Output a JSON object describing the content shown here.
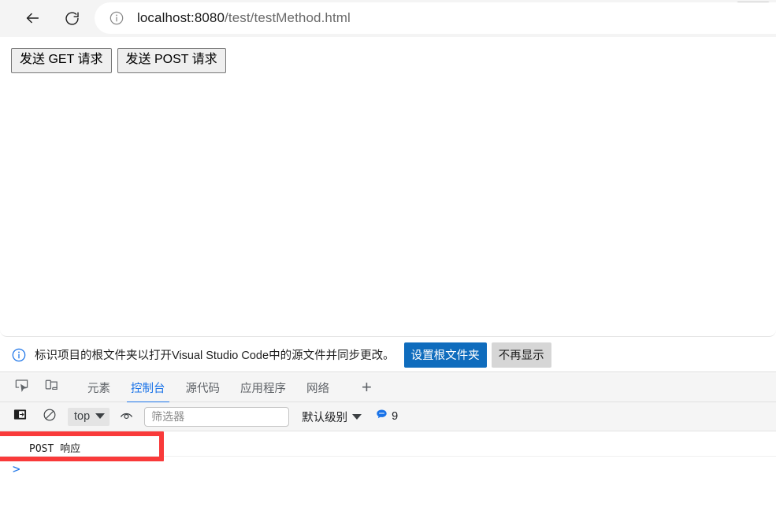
{
  "browser": {
    "back_icon": "back-arrow-icon",
    "reload_icon": "reload-icon",
    "info_icon": "info-circle-icon",
    "url_host": "localhost:8080",
    "url_path": "/test/testMethod.html"
  },
  "page": {
    "buttons": [
      {
        "label": "发送 GET 请求"
      },
      {
        "label": "发送 POST 请求"
      }
    ]
  },
  "infobar": {
    "icon": "info-circle-icon",
    "message": "标识项目的根文件夹以打开Visual Studio Code中的源文件并同步更改。",
    "primary_button": "设置根文件夹",
    "secondary_button": "不再显示",
    "primary_color": "#0f6cbd"
  },
  "devtools": {
    "inspect_icon": "inspect-element-icon",
    "device_icon": "device-toolbar-icon",
    "tabs": [
      {
        "label": "元素",
        "active": false
      },
      {
        "label": "控制台",
        "active": true
      },
      {
        "label": "源代码",
        "active": false
      },
      {
        "label": "应用程序",
        "active": false
      },
      {
        "label": "网络",
        "active": false
      }
    ],
    "more_tabs_label": "+",
    "active_tab_color": "#1a73e8"
  },
  "console_toolbar": {
    "sidebar_icon": "console-sidebar-icon",
    "clear_icon": "clear-console-icon",
    "context_label": "top",
    "eye_icon": "live-expression-icon",
    "filter_placeholder": "筛选器",
    "filter_value": "",
    "level_label": "默认级别",
    "message_badge_icon": "message-bubble-icon",
    "message_count": "9",
    "badge_color": "#1a73e8"
  },
  "console": {
    "messages": [
      {
        "text": "POST 响应"
      }
    ],
    "prompt_caret": ">",
    "prompt_value": ""
  },
  "annotation": {
    "highlight_color": "#f93a3a"
  }
}
